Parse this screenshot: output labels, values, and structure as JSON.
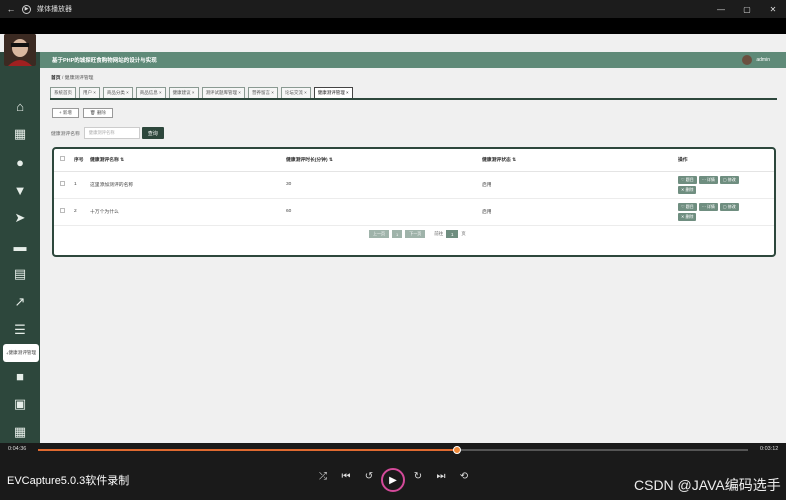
{
  "window": {
    "title": "媒体播放器",
    "back": "←",
    "min": "—",
    "max": "▢",
    "close": "✕"
  },
  "app": {
    "header_title": "基于PHP的城探旺食购物网站的设计与实现",
    "user": "admin",
    "breadcrumb": {
      "home": "首页",
      "sep": "/",
      "current": "健康测评管理"
    },
    "tags": [
      "系统首页",
      "用户 ×",
      "商品分类 ×",
      "商品信息 ×",
      "健康建议 ×",
      "测评试题库管理 ×",
      "营养留言 ×",
      "论坛交流 ×",
      "健康测评管理 ×"
    ],
    "buttons": {
      "add": "+ 新增",
      "delete": "删除"
    },
    "search": {
      "label": "健康测评名称",
      "placeholder": "健康测评名称",
      "button": "查询"
    },
    "table": {
      "headers": [
        "序号",
        "健康测评名称 ⇅",
        "健康测评时长(分钟) ⇅",
        "健康测评状态 ⇅",
        "操作"
      ],
      "rows": [
        {
          "index": "1",
          "name": "这里添加测评的名称",
          "duration": "30",
          "status": "启用"
        },
        {
          "index": "2",
          "name": "十万个为什么",
          "duration": "60",
          "status": "启用"
        }
      ],
      "ops": [
        "题目",
        "详情",
        "修改",
        "删除"
      ]
    },
    "pagination": {
      "prev": "上一页",
      "page": "1",
      "next": "下一页",
      "goto": "前往",
      "goto_value": "1",
      "unit": "页"
    },
    "tooltip": "健康测评管理"
  },
  "player": {
    "elapsed": "0:04:36",
    "total": "0:03:12",
    "progress": 0.59,
    "brand": "EVCapture5.0.3软件录制",
    "watermark": "CSDN @JAVA编码选手"
  }
}
